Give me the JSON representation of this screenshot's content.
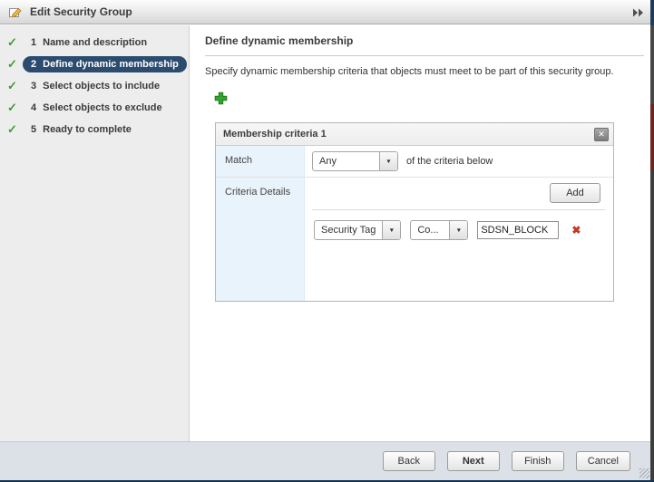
{
  "window": {
    "title": "Edit Security Group"
  },
  "icons": {
    "check": "✓",
    "close": "✕",
    "delete": "✖",
    "dropdown": "▼"
  },
  "colors": {
    "accent_navy": "#2b4b6f",
    "check_green": "#3f9c35",
    "plus_green": "#35a42f",
    "delete_red": "#c0392b",
    "label_cell_blue": "#e9f3fb",
    "footer_bg": "#dbe1e7"
  },
  "wizard": {
    "steps": [
      {
        "num": "1",
        "label": "Name and description",
        "checked": true,
        "active": false
      },
      {
        "num": "2",
        "label": "Define dynamic membership",
        "checked": true,
        "active": true
      },
      {
        "num": "3",
        "label": "Select objects to include",
        "checked": true,
        "active": false
      },
      {
        "num": "4",
        "label": "Select objects to exclude",
        "checked": true,
        "active": false
      },
      {
        "num": "5",
        "label": "Ready to complete",
        "checked": true,
        "active": false
      }
    ]
  },
  "content": {
    "heading": "Define dynamic membership",
    "description": "Specify dynamic membership criteria that objects must meet to be part of this security group.",
    "panel": {
      "title": "Membership criteria 1",
      "match": {
        "label": "Match",
        "value": "Any",
        "suffix": "of the criteria below"
      },
      "details": {
        "label": "Criteria Details",
        "add_button": "Add"
      },
      "criteria_rows": [
        {
          "type": "Security Tag",
          "operator": "Co...",
          "value": "SDSN_BLOCK"
        }
      ]
    }
  },
  "footer": {
    "buttons": [
      "Back",
      "Next",
      "Finish",
      "Cancel"
    ],
    "default_button": "Next"
  }
}
